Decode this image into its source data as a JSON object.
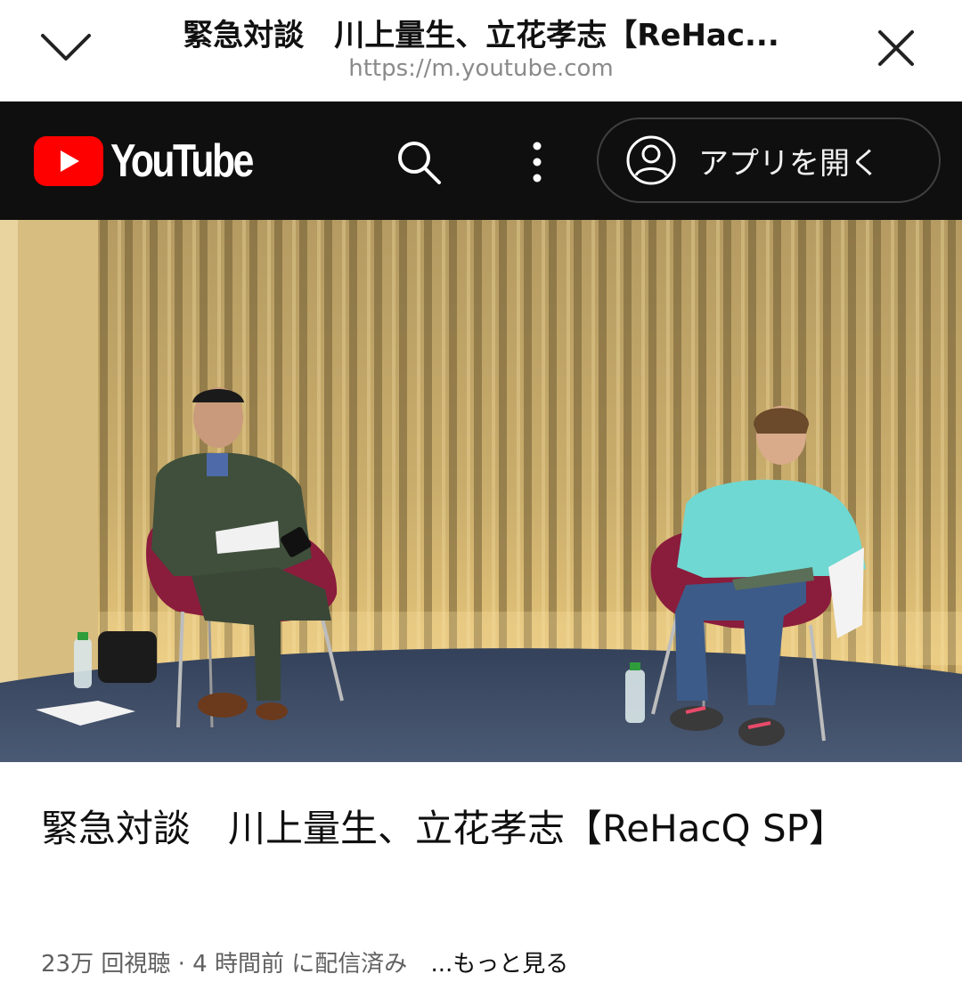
{
  "browser": {
    "title": "緊急対談　川上量生、立花孝志【ReHac...",
    "url": "https://m.youtube.com"
  },
  "youtube": {
    "logo_text": "YouTube",
    "open_app_label": "アプリを開く"
  },
  "video": {
    "title": "緊急対談　川上量生、立花孝志【ReHacQ SP】",
    "views": "23万 回視聴",
    "separator": "·",
    "time": "4 時間前",
    "status": "に配信済み",
    "more_label": "...もっと見る"
  },
  "colors": {
    "brand_red": "#ff0000",
    "header_bg": "#0f0f0f"
  },
  "icons": [
    "chevron-down-icon",
    "close-icon",
    "youtube-play-icon",
    "search-icon",
    "more-vertical-icon",
    "account-icon"
  ]
}
